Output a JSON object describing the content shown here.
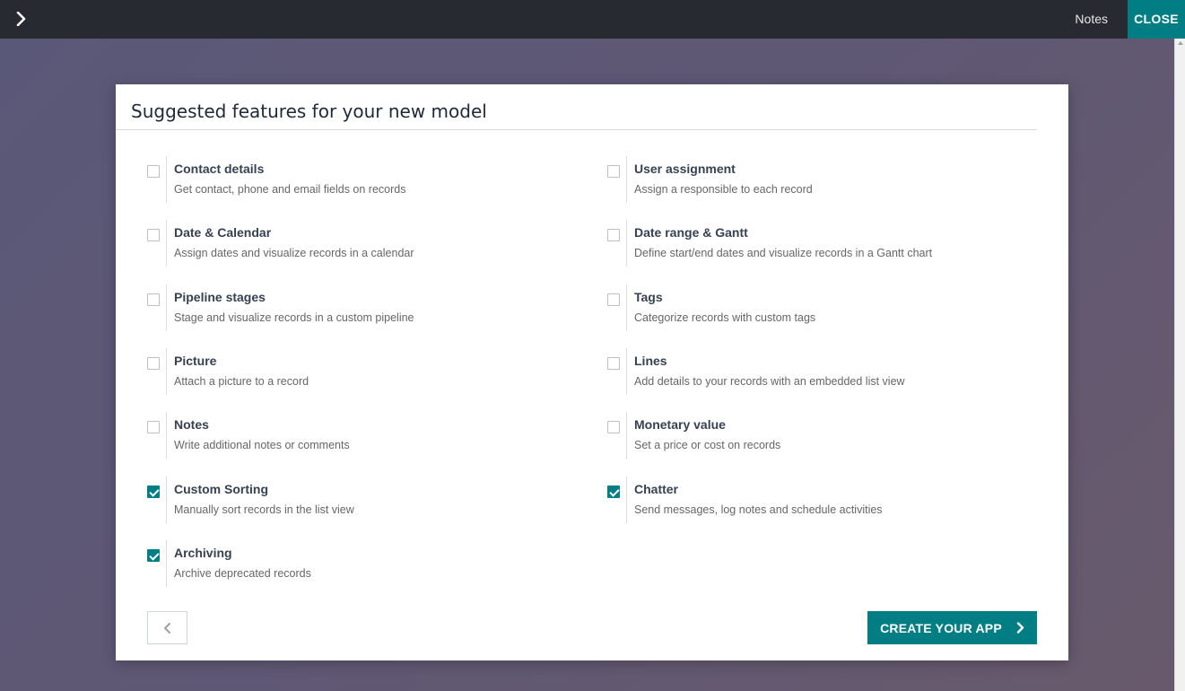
{
  "topbar": {
    "notes_label": "Notes",
    "close_label": "CLOSE",
    "accent": "#017e84",
    "background": "#272a30"
  },
  "dialog": {
    "title": "Suggested features for your new model",
    "features": [
      {
        "name": "Contact details",
        "desc": "Get contact, phone and email fields on records",
        "checked": false
      },
      {
        "name": "User assignment",
        "desc": "Assign a responsible to each record",
        "checked": false
      },
      {
        "name": "Date & Calendar",
        "desc": "Assign dates and visualize records in a calendar",
        "checked": false
      },
      {
        "name": "Date range & Gantt",
        "desc": "Define start/end dates and visualize records in a Gantt chart",
        "checked": false
      },
      {
        "name": "Pipeline stages",
        "desc": "Stage and visualize records in a custom pipeline",
        "checked": false
      },
      {
        "name": "Tags",
        "desc": "Categorize records with custom tags",
        "checked": false
      },
      {
        "name": "Picture",
        "desc": "Attach a picture to a record",
        "checked": false
      },
      {
        "name": "Lines",
        "desc": "Add details to your records with an embedded list view",
        "checked": false
      },
      {
        "name": "Notes",
        "desc": "Write additional notes or comments",
        "checked": false
      },
      {
        "name": "Monetary value",
        "desc": "Set a price or cost on records",
        "checked": false
      },
      {
        "name": "Custom Sorting",
        "desc": "Manually sort records in the list view",
        "checked": true
      },
      {
        "name": "Chatter",
        "desc": "Send messages, log notes and schedule activities",
        "checked": true
      },
      {
        "name": "Archiving",
        "desc": "Archive deprecated records",
        "checked": true
      }
    ],
    "back_icon": "chevron-left-icon",
    "create_label": "CREATE YOUR APP",
    "create_icon": "chevron-right-icon"
  }
}
